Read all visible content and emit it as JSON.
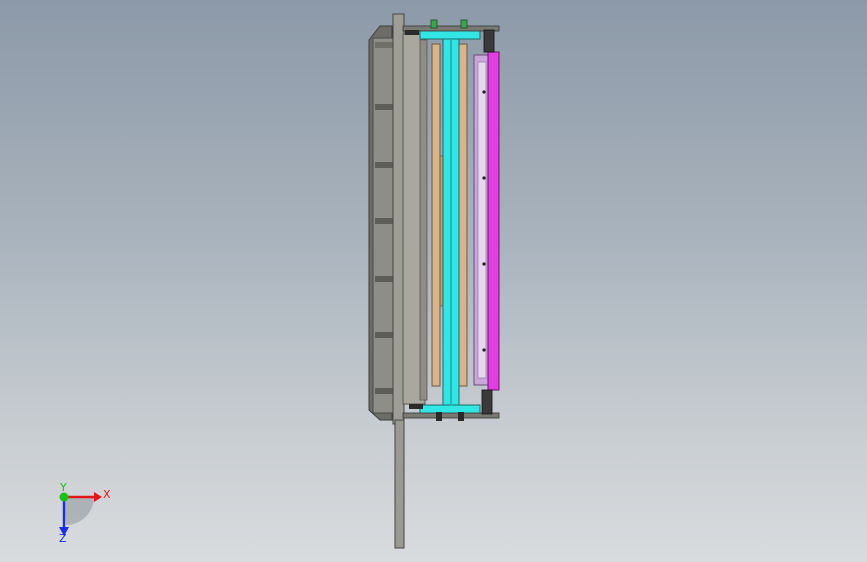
{
  "viewport": {
    "background_top": "#8c99a8",
    "background_bottom": "#d9dcdf"
  },
  "model": {
    "colors": {
      "housing": "#9a9a92",
      "housing_dark": "#5e5e5a",
      "inner_plate": "#a7a59c",
      "cyan_shaft": "#33e6e6",
      "tan_rail": "#d8b48a",
      "magenta_panel": "#e040e0",
      "lavender_frame": "#c9a8d8",
      "fastener": "#2a2a2a",
      "green_part": "#3fa34d"
    }
  },
  "triad": {
    "x_label": "X",
    "y_label": "Y",
    "z_label": "Z",
    "x_color": "#e0181a",
    "y_color": "#18c018",
    "z_color": "#1a2ee0"
  }
}
